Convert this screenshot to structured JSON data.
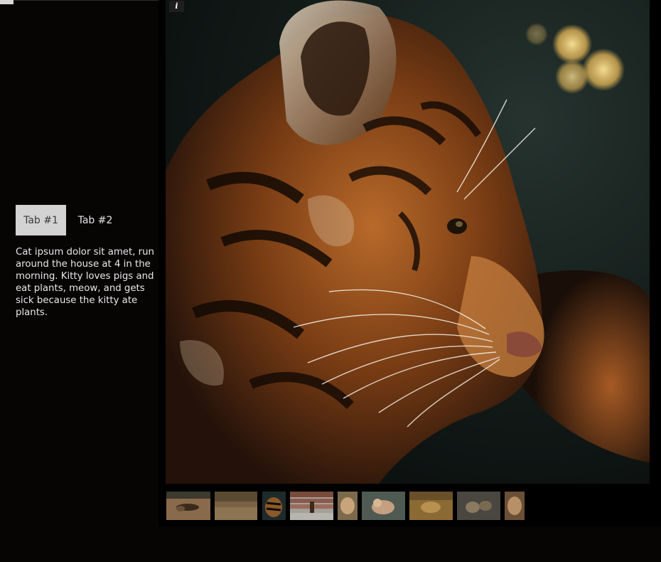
{
  "tabs": [
    {
      "label": "Tab #1",
      "active": true
    },
    {
      "label": "Tab #2",
      "active": false
    }
  ],
  "tab_content": "Cat ipsum dolor sit amet, run around the house at 4 in the morning. Kitty loves pigs and eat plants, meow, and gets sick because the kitty ate plants.",
  "gallery": {
    "info_label": "i",
    "main_image_icon": "tiger-cub-photo",
    "thumbnails": [
      {
        "icon": "lion-cubs-lying-thumbnail"
      },
      {
        "icon": "grass-field-thumbnail"
      },
      {
        "icon": "tiger-cub-thumbnail"
      },
      {
        "icon": "cat-on-steps-thumbnail"
      },
      {
        "icon": "lion-cub-thumbnail"
      },
      {
        "icon": "lion-resting-thumbnail"
      },
      {
        "icon": "leopard-in-grass-thumbnail"
      },
      {
        "icon": "cubs-on-rocks-thumbnail"
      },
      {
        "icon": "lion-cub-face-thumbnail"
      }
    ]
  },
  "colors": {
    "page_background": "#070404",
    "gallery_background": "#000000",
    "active_tab_background": "#d3d3d3",
    "text": "#e8e8e8"
  }
}
